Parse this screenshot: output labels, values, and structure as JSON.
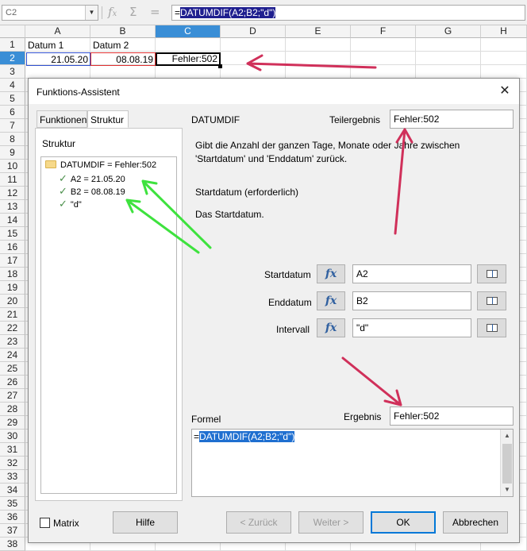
{
  "formula_bar": {
    "name_box": "C2",
    "fx_icon": "fx-icon",
    "sum_icon": "sum-icon",
    "equals_icon": "equals-icon",
    "content_prefix": "=",
    "content_selected": "DATUMDIF(A2;B2;\"d\")"
  },
  "sheet": {
    "columns": [
      "A",
      "B",
      "C",
      "D",
      "E",
      "F",
      "G",
      "H"
    ],
    "rows": [
      "1",
      "2",
      "3",
      "4",
      "5",
      "6",
      "7",
      "8",
      "9",
      "10",
      "11",
      "12",
      "13",
      "14",
      "15",
      "16",
      "17",
      "18",
      "19",
      "20",
      "21",
      "22",
      "23",
      "24",
      "25",
      "26",
      "27",
      "28",
      "29",
      "30",
      "31",
      "32",
      "33",
      "34",
      "35",
      "36",
      "37",
      "38"
    ],
    "active_column": "C",
    "active_row": "2",
    "cells": {
      "A1": "Datum 1",
      "B1": "Datum 2",
      "A2": "21.05.20",
      "B2": "08.08.19",
      "C2": "Fehler:502"
    }
  },
  "dialog": {
    "title": "Funktions-Assistent",
    "tabs": [
      "Funktionen",
      "Struktur"
    ],
    "active_tab": "Struktur",
    "structure_label": "Struktur",
    "tree": {
      "root": "DATUMDIF = Fehler:502",
      "children": [
        "A2 = 21.05.20",
        "B2 = 08.08.19",
        "\"d\""
      ]
    },
    "function_name": "DATUMDIF",
    "partial_result_label": "Teilergebnis",
    "partial_result_value": "Fehler:502",
    "description": "Gibt die Anzahl der ganzen Tage, Monate oder Jahre zwischen 'Startdatum' und 'Enddatum' zurück.",
    "param_title": "Startdatum (erforderlich)",
    "param_desc": "Das Startdatum.",
    "params": [
      {
        "label": "Startdatum",
        "value": "A2"
      },
      {
        "label": "Enddatum",
        "value": "B2"
      },
      {
        "label": "Intervall",
        "value": "\"d\""
      }
    ],
    "fx_label": "fx",
    "formula_label": "Formel",
    "result_label": "Ergebnis",
    "result_value": "Fehler:502",
    "formula_prefix": "=",
    "formula_selected": "DATUMDIF(A2;B2;\"d\")",
    "matrix_label": "Matrix",
    "buttons": {
      "help": "Hilfe",
      "back": "< Zurück",
      "next": "Weiter >",
      "ok": "OK",
      "cancel": "Abbrechen"
    }
  },
  "annotation_colors": {
    "red": "#d0305a",
    "green": "#3ee23e"
  }
}
